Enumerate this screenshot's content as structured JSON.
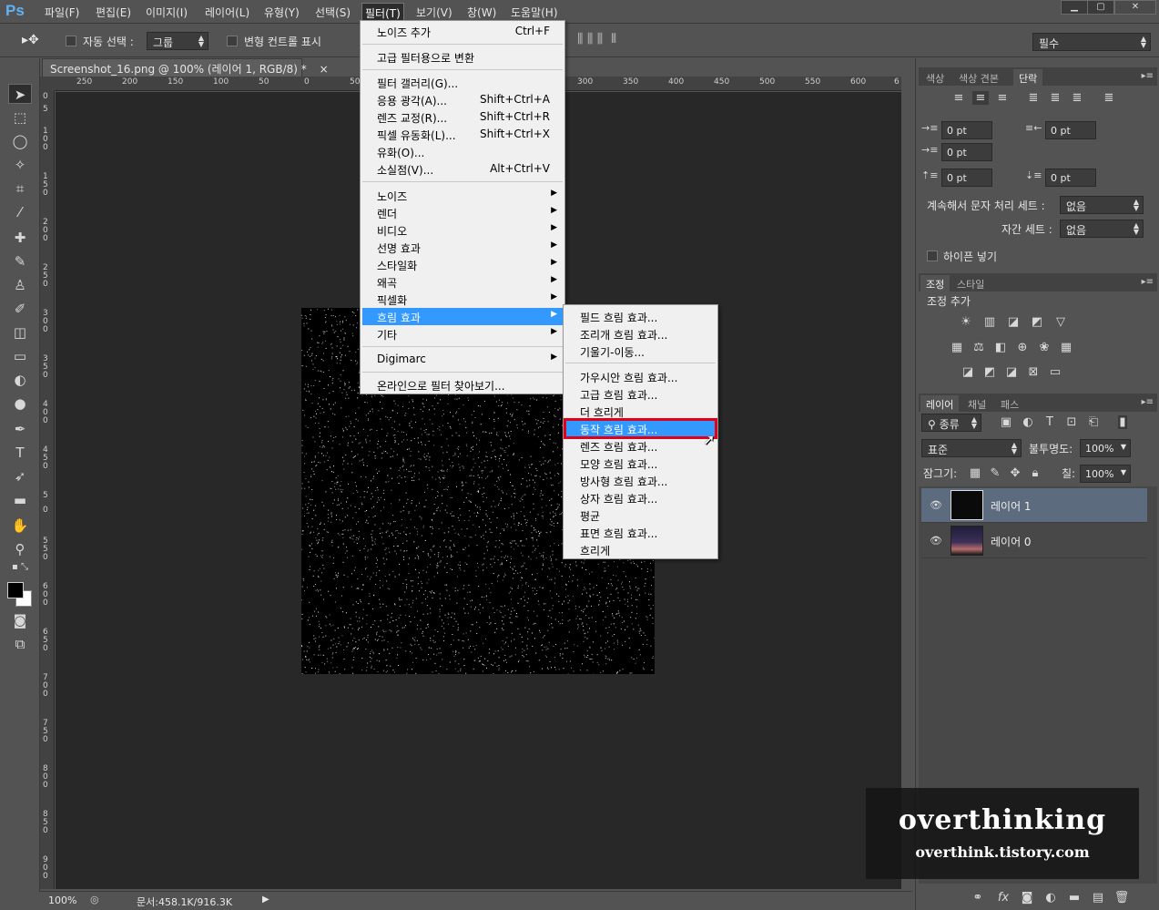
{
  "app": {
    "logo": "Ps"
  },
  "menubar": {
    "items": [
      "파일(F)",
      "편집(E)",
      "이미지(I)",
      "레이어(L)",
      "유형(Y)",
      "선택(S)",
      "필터(T)",
      "보기(V)",
      "창(W)",
      "도움말(H)"
    ],
    "active": "필터(T)"
  },
  "window_controls": {
    "minimize": "▁",
    "maximize": "▢",
    "close": "✕"
  },
  "options_bar": {
    "auto_select_label": "자동 선택 :",
    "auto_select_value": "그룹",
    "transform_controls_label": "변형 컨트롤 표시",
    "workspace": "필수"
  },
  "document": {
    "tab_title": "Screenshot_16.png @ 100% (레이어 1, RGB/8) *",
    "close_symbol": "×",
    "ruler_h": [
      "250",
      "200",
      "150",
      "100",
      "50",
      "0",
      "50",
      "300",
      "350",
      "400",
      "450",
      "500",
      "550",
      "600",
      "6"
    ],
    "ruler_v": [
      "0",
      "5",
      "100",
      "150",
      "200",
      "250",
      "300",
      "350",
      "400",
      "450",
      "5",
      "0",
      "550",
      "600",
      "650",
      "700",
      "750",
      "800",
      "850",
      "900"
    ]
  },
  "status_bar": {
    "zoom": "100%",
    "doc_size": "문서:458.1K/916.3K",
    "arrow": "▶"
  },
  "filter_menu": {
    "items": [
      {
        "label": "노이즈 추가",
        "shortcut": "Ctrl+F"
      },
      {
        "label": "고급 필터용으로 변환",
        "shortcut": ""
      },
      {
        "label": "필터 갤러리(G)...",
        "shortcut": ""
      },
      {
        "label": "응용 광각(A)...",
        "shortcut": "Shift+Ctrl+A"
      },
      {
        "label": "렌즈 교정(R)...",
        "shortcut": "Shift+Ctrl+R"
      },
      {
        "label": "픽셀 유동화(L)...",
        "shortcut": "Shift+Ctrl+X"
      },
      {
        "label": "유화(O)...",
        "shortcut": ""
      },
      {
        "label": "소실점(V)...",
        "shortcut": "Alt+Ctrl+V"
      },
      {
        "label": "노이즈",
        "shortcut": ""
      },
      {
        "label": "렌더",
        "shortcut": ""
      },
      {
        "label": "비디오",
        "shortcut": ""
      },
      {
        "label": "선명 효과",
        "shortcut": ""
      },
      {
        "label": "스타일화",
        "shortcut": ""
      },
      {
        "label": "왜곡",
        "shortcut": ""
      },
      {
        "label": "픽셀화",
        "shortcut": ""
      },
      {
        "label": "흐림 효과",
        "shortcut": ""
      },
      {
        "label": "기타",
        "shortcut": ""
      },
      {
        "label": "Digimarc",
        "shortcut": ""
      },
      {
        "label": "온라인으로 필터 찾아보기...",
        "shortcut": ""
      }
    ]
  },
  "blur_submenu": {
    "items": [
      "필드 흐림 효과...",
      "조리개 흐림 효과...",
      "기울기-이동...",
      "가우시안 흐림 효과...",
      "고급 흐림 효과...",
      "더 흐리게",
      "동작 흐림 효과...",
      "렌즈 흐림 효과...",
      "모양 흐림 효과...",
      "방사형 흐림 효과...",
      "상자 흐림 효과...",
      "평균",
      "표면 흐림 효과...",
      "흐리게"
    ],
    "highlighted": "동작 흐림 효과..."
  },
  "paragraph_panel": {
    "tabs": [
      "색상",
      "색상 견본",
      "단락"
    ],
    "active_tab": "단락",
    "indent_left": "0 pt",
    "indent_right": "0 pt",
    "first_line": "0 pt",
    "space_before": "0 pt",
    "space_after": "0 pt",
    "kinsoku_label": "계속해서 문자 처리 세트 :",
    "kinsoku_value": "없음",
    "mojikumi_label": "자간 세트 :",
    "mojikumi_value": "없음",
    "hyphenate_label": "하이픈 넣기"
  },
  "adjustments_panel": {
    "tabs": [
      "조정",
      "스타일"
    ],
    "active_tab": "조정",
    "title": "조정 추가"
  },
  "layers_panel": {
    "tabs": [
      "레이어",
      "채널",
      "패스"
    ],
    "active_tab": "레이어",
    "filter_kind": "종류",
    "blend_mode": "표준",
    "opacity_label": "불투명도:",
    "opacity": "100%",
    "lock_label": "잠그기:",
    "fill_label": "칠:",
    "fill": "100%",
    "layers": [
      {
        "name": "레이어 1",
        "selected": true
      },
      {
        "name": "레이어 0",
        "selected": false
      }
    ]
  },
  "watermark": {
    "title": "overthinking",
    "url": "overthink.tistory.com"
  },
  "colors": {
    "highlight": "#3399ff",
    "selected_layer": "#5c6b7d",
    "red_outline": "#e0001a"
  }
}
